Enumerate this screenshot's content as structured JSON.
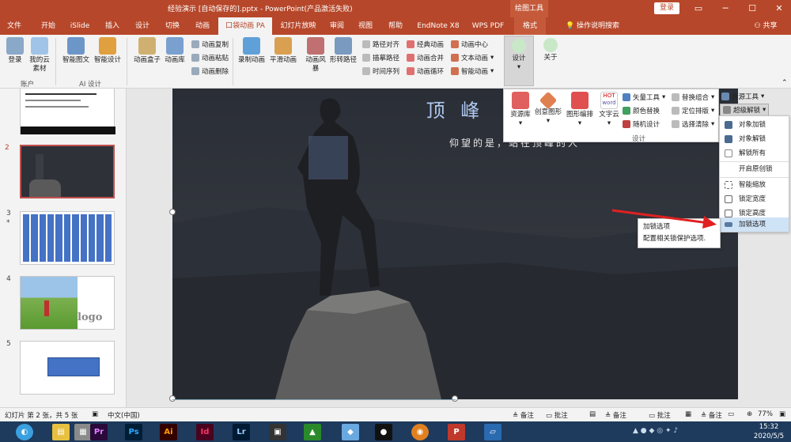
{
  "title_bar": {
    "document_title": "经验演示 [自动保存的].pptx - PowerPoint(产品激活失败)",
    "context_label": "绘图工具",
    "login_label": "登录",
    "restore_icon": "restore-icon",
    "minimize_icon": "minimize-icon",
    "maximize_icon": "maximize-icon",
    "close_icon": "close-icon"
  },
  "tabs": [
    "文件",
    "开始",
    "iSlide",
    "插入",
    "设计",
    "切换",
    "动画",
    "口袋动画 PA",
    "幻灯片放映",
    "审阅",
    "视图",
    "帮助",
    "EndNote X8",
    "WPS PDF",
    "格式"
  ],
  "active_tab": "口袋动画 PA",
  "tell_me": "操作说明搜索",
  "share": "共享",
  "ribbon": {
    "account": {
      "login": "登录",
      "materials": "我的云素材",
      "label": "账户"
    },
    "ai": {
      "smart_text": "智能图文",
      "smart_design": "智能设计",
      "label": "AI 设计"
    },
    "anim": {
      "box": "动画盒子",
      "lib": "动画库",
      "copy": "动画复制",
      "paste": "动画粘贴",
      "delete": "动画删除",
      "record": "录制动画",
      "smooth": "平滑动画",
      "style": "动画风暴",
      "path": "形转路径",
      "path_align": "路径对齐",
      "trace": "描摹路径",
      "timeline": "时间序列",
      "classic": "经典动画",
      "merge": "动画合并",
      "loop": "动画循环",
      "center": "动画中心",
      "text_anim": "文本动画",
      "smart_anim": "智能动画"
    },
    "design": "设计",
    "about": "关于"
  },
  "popup": {
    "lib": "资源库",
    "creative": "创意图形",
    "layout": "图形编排",
    "textcloud": "文字云",
    "hot": "HOT",
    "word": "word",
    "vector": "矢量工具",
    "color_replace": "颜色替换",
    "random": "随机设计",
    "replace_group": "替换组合",
    "position": "定位排版",
    "select_clear": "选择清除",
    "resource": "资源工具",
    "super_unlock": "超级解锁",
    "group_label": "设计"
  },
  "menu": [
    "对象加锁",
    "对象解锁",
    "解锁所有",
    "开启原创锁",
    "智能缩放",
    "锁定宽度",
    "锁定高度",
    "加锁选项"
  ],
  "tooltip": {
    "title": "加锁选项",
    "desc": "配置相关锁保护选项."
  },
  "slide": {
    "title": "顶 峰",
    "subtitle": "仰望的是，站在顶峰的人"
  },
  "thumbs": {
    "n2": "2",
    "n3": "3",
    "n3star": "*",
    "n4": "4",
    "n5": "5",
    "logo": "logo"
  },
  "status": {
    "slide_info": "幻灯片 第 2 张，共 5 张",
    "lang": "中文(中国)",
    "notes": "备注",
    "comments": "批注",
    "zoom": "77%"
  },
  "taskbar": {
    "time": "15:32",
    "date": "2020/5/5"
  },
  "colors": {
    "accent": "#b7472a",
    "taskbar": "#1e3a5c",
    "highlight": "#cfe3f7",
    "arrow": "#e02020"
  }
}
